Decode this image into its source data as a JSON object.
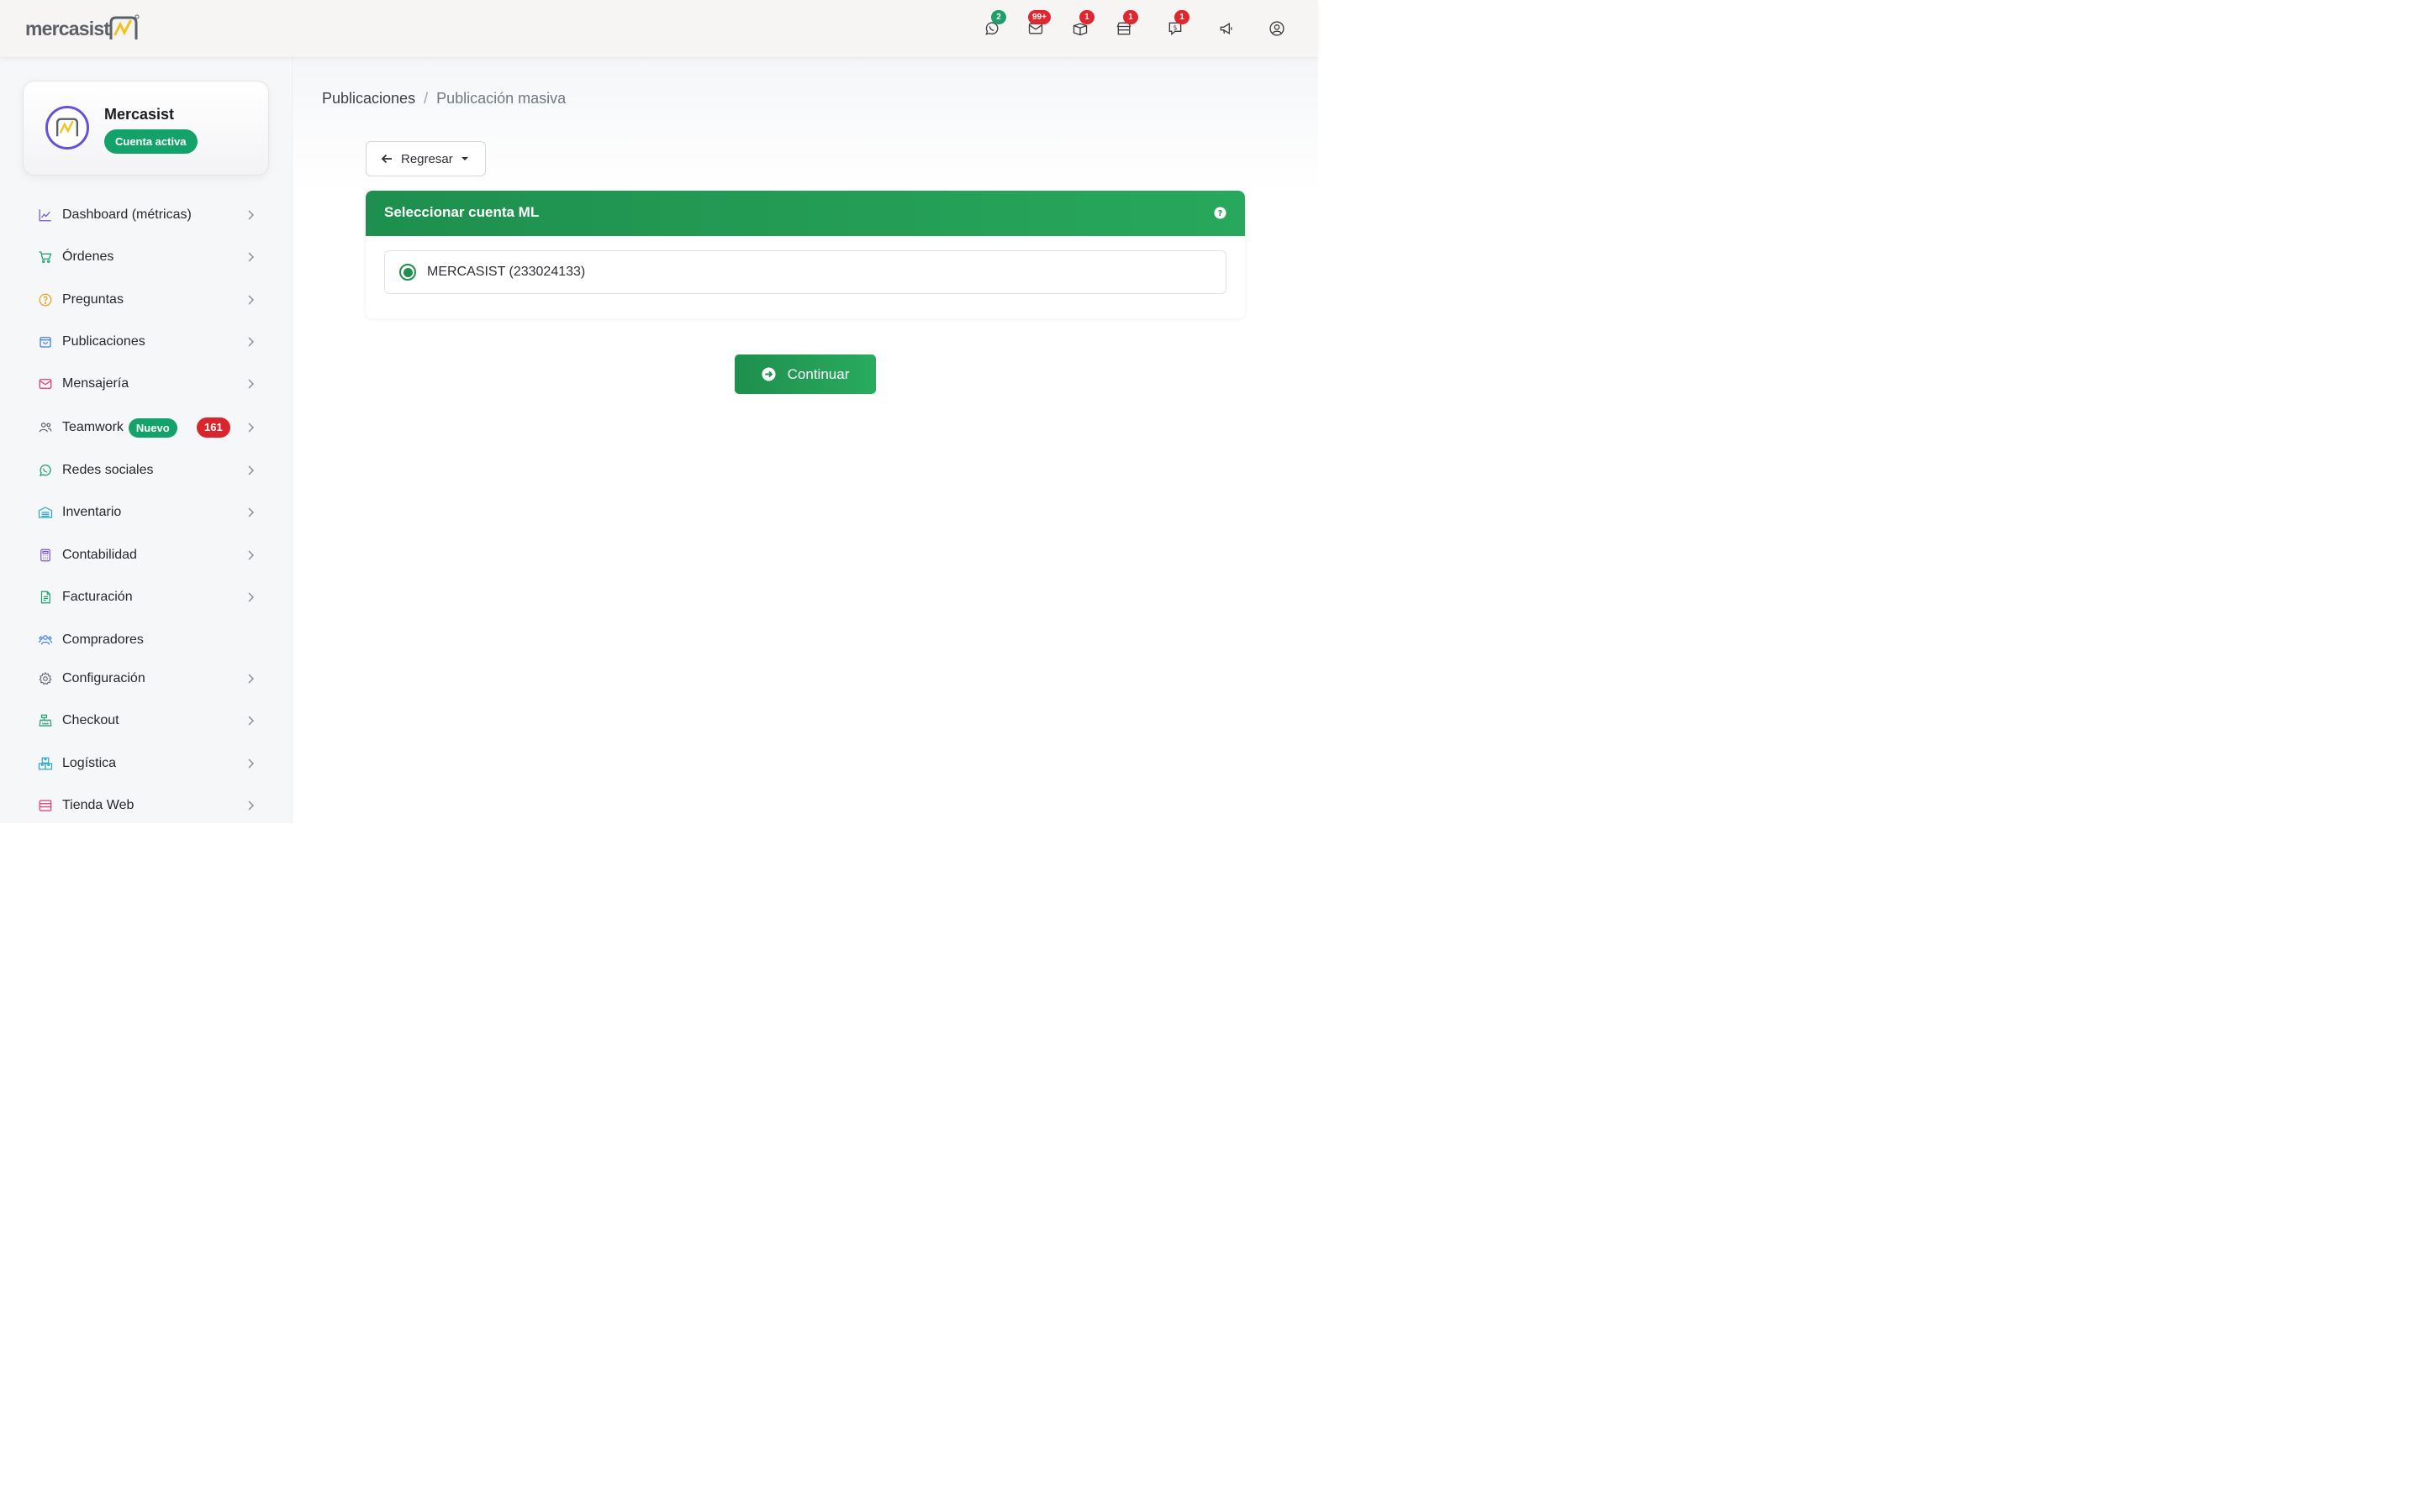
{
  "header": {
    "logo_text": "mercasist",
    "icons": [
      {
        "name": "whatsapp-icon",
        "badge": "2",
        "badge_color": "green"
      },
      {
        "name": "mail-icon",
        "badge": "99+",
        "badge_color": "red"
      },
      {
        "name": "package-icon",
        "badge": "1",
        "badge_color": "red"
      },
      {
        "name": "store-icon",
        "badge": "1",
        "badge_color": "red"
      },
      {
        "name": "money-message-icon",
        "badge": "1",
        "badge_color": "red"
      },
      {
        "name": "megaphone-icon",
        "badge": null
      },
      {
        "name": "user-circle-icon",
        "badge": null
      }
    ]
  },
  "sidebar": {
    "profile": {
      "name": "Mercasist",
      "status": "Cuenta activa"
    },
    "items": [
      {
        "label": "Dashboard (métricas)",
        "icon": "chart-line-icon",
        "color": "#7b55d6"
      },
      {
        "label": "Órdenes",
        "icon": "cart-icon",
        "color": "#1fa06a"
      },
      {
        "label": "Preguntas",
        "icon": "question-circle-icon",
        "color": "#f0a020"
      },
      {
        "label": "Publicaciones",
        "icon": "shopping-bag-icon",
        "color": "#3d7fe0"
      },
      {
        "label": "Mensajería",
        "icon": "envelope-icon",
        "color": "#e03a6f"
      },
      {
        "label": "Teamwork",
        "icon": "users-icon",
        "color": "#5b5f66",
        "tag": "Nuevo",
        "count": "161"
      },
      {
        "label": "Redes sociales",
        "icon": "whatsapp-icon",
        "color": "#1fa06a"
      },
      {
        "label": "Inventario",
        "icon": "warehouse-icon",
        "color": "#2aa6c8"
      },
      {
        "label": "Contabilidad",
        "icon": "calculator-icon",
        "color": "#7b55d6"
      },
      {
        "label": "Facturación",
        "icon": "invoice-icon",
        "color": "#1fa06a"
      },
      {
        "label": "Compradores",
        "icon": "buyers-icon",
        "color": "#3d7fe0"
      },
      {
        "label": "Configuración",
        "icon": "gear-icon",
        "color": "#6b7079"
      },
      {
        "label": "Checkout",
        "icon": "cash-register-icon",
        "color": "#1fa06a"
      },
      {
        "label": "Logística",
        "icon": "boxes-icon",
        "color": "#2aa6c8"
      },
      {
        "label": "Tienda Web",
        "icon": "web-store-icon",
        "color": "#e03a6f"
      }
    ]
  },
  "breadcrumb": {
    "parent": "Publicaciones",
    "separator": "/",
    "current": "Publicación masiva"
  },
  "back_button": {
    "label": "Regresar"
  },
  "account_card": {
    "title": "Seleccionar cuenta ML",
    "accounts": [
      {
        "label": "MERCASIST (233024133)",
        "selected": true
      }
    ]
  },
  "continue_button": {
    "label": "Continuar"
  },
  "colors": {
    "accent_green": "#1e8f4e",
    "badge_red": "#e0262f",
    "sidebar_bg": "#f6f7f9"
  }
}
